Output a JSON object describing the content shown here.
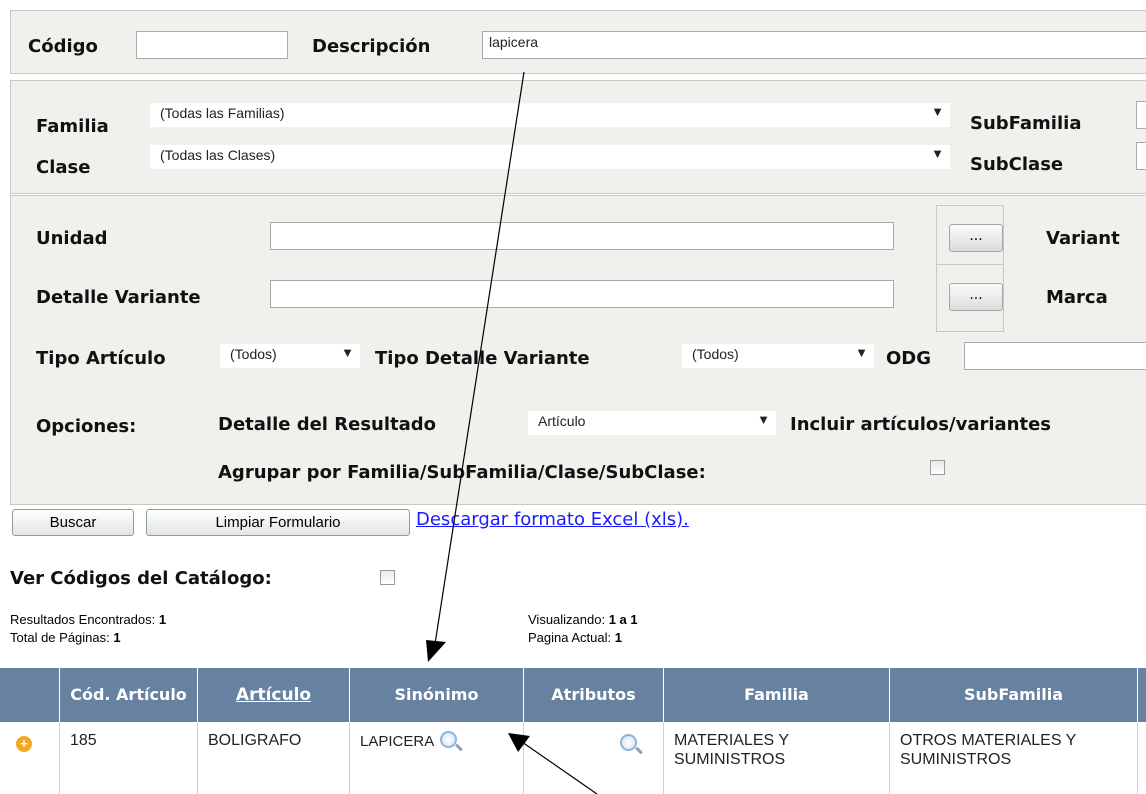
{
  "search": {
    "codigo_label": "Código",
    "codigo_value": "",
    "descripcion_label": "Descripción",
    "descripcion_value": "lapicera"
  },
  "classification": {
    "familia_label": "Familia",
    "familia_value": "(Todas las Familias)",
    "subfamilia_label": "SubFamilia",
    "clase_label": "Clase",
    "clase_value": "(Todas las Clases)",
    "subclase_label": "SubClase"
  },
  "details": {
    "unidad_label": "Unidad",
    "unidad_value": "",
    "ellipsis_label": "...",
    "variante_label": "Variant",
    "detalle_variante_label": "Detalle Variante",
    "detalle_variante_value": "",
    "marca_label": "Marca",
    "tipo_articulo_label": "Tipo Artículo",
    "tipo_articulo_value": "(Todos)",
    "tipo_detalle_label": "Tipo Detalle Variante",
    "tipo_detalle_value": "(Todos)",
    "odg_label": "ODG",
    "opciones_label": "Opciones:",
    "detalle_resultado_label": "Detalle del Resultado",
    "detalle_resultado_value": "Artículo",
    "incluir_label": "Incluir artículos/variantes",
    "agrupar_label": "Agrupar por Familia/SubFamilia/Clase/SubClase:"
  },
  "actions": {
    "buscar": "Buscar",
    "limpiar": "Limpiar Formulario",
    "excel_link": "Descargar formato Excel (xls)."
  },
  "catalog": {
    "ver_codigos_label": "Ver Códigos del Catálogo:"
  },
  "stats": {
    "resultados_label": "Resultados Encontrados:",
    "resultados_value": "1",
    "total_paginas_label": "Total de Páginas:",
    "total_paginas_value": "1",
    "visualizando_label": "Visualizando:",
    "visualizando_value": "1 a 1",
    "pagina_actual_label": "Pagina Actual:",
    "pagina_actual_value": "1"
  },
  "table": {
    "headers": [
      "Cód. Artículo",
      "Artículo",
      "Sinónimo",
      "Atributos",
      "Familia",
      "SubFamilia"
    ],
    "rows": [
      {
        "codigo": "185",
        "articulo": "BOLIGRAFO",
        "sinonimo": "LAPICERA",
        "familia": "MATERIALES Y SUMINISTROS",
        "subfamilia": "OTROS MATERIALES Y SUMINISTROS"
      }
    ]
  },
  "colors": {
    "panel_bg": "#f0f0ec",
    "table_header_bg": "#6781a1",
    "link": "#1a1aff",
    "expand_icon": "#f5a623"
  }
}
